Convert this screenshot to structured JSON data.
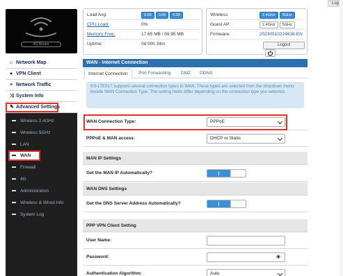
{
  "topbar": {
    "log_label": "Log"
  },
  "logo": {
    "label": "4G Router"
  },
  "status": {
    "load_avg": {
      "label": "Load Avg:",
      "values": [
        "0.00",
        "0.00",
        "0.00"
      ]
    },
    "cpu_load": {
      "label": "CPU Load:",
      "value": "0%"
    },
    "memory_free": {
      "label": "Memory Free:",
      "value": "17.65 MB / 59.95 MB"
    },
    "uptime": {
      "label": "Uptime:",
      "value": "0d 00h 34m"
    },
    "wireless": {
      "label": "Wireless:",
      "bands": [
        "2.4GHz",
        "5GHz"
      ]
    },
    "guest_ap": {
      "label": "Guest AP:",
      "bands": [
        "2.4GHz",
        "5GHz"
      ]
    },
    "firmware": {
      "label": "Firmware:",
      "value": "20230510224638-EN"
    },
    "logout_label": "Logout"
  },
  "sidebar": {
    "items": [
      {
        "label": "Network Map",
        "icon": "home-icon"
      },
      {
        "label": "VPN Client",
        "icon": "globe-icon"
      },
      {
        "label": "Network Traffic",
        "icon": "list-icon"
      },
      {
        "label": "System Info",
        "icon": "shuffle-icon"
      },
      {
        "label": "Advanced Settings",
        "icon": "wrench-icon"
      }
    ],
    "subitems": [
      {
        "label": "Wireless 2.4GHz"
      },
      {
        "label": "Wireless 5GHz"
      },
      {
        "label": "LAN"
      },
      {
        "label": "WAN"
      },
      {
        "label": "Firewall"
      },
      {
        "label": "4G"
      },
      {
        "label": "Administration"
      },
      {
        "label": "Wireless & Wired Info"
      },
      {
        "label": "System Log"
      }
    ]
  },
  "main": {
    "title": "WAN - Internet Connection",
    "tabs": [
      "Internet Connection",
      "Port Forwarding",
      "DMZ",
      "DDNS"
    ],
    "note": "KS-LTE517 supports several connection types to WAN. These types are selected from the dropdown menu beside WAN Connection Type. The setting fields differ depending on the connection type you selected.",
    "wan_type": {
      "label": "WAN Connection Type:",
      "value": "PPPoE"
    },
    "pppoe_mac": {
      "label": "PPPoE & MAN access:",
      "value": "DHCP or Static"
    },
    "man_ip_section": "MAN IP Settings",
    "man_ip_auto": {
      "label": "Get the MAN IP Automatically?",
      "toggle": "I"
    },
    "wan_dns_section": "WAN DNS Settings",
    "dns_auto": {
      "label": "Get the DNS Server Address Automatically?",
      "toggle": "I"
    },
    "ppp_section": "PPP VPN Client Setting",
    "username": {
      "label": "User Name:",
      "value": ""
    },
    "password": {
      "label": "Password:",
      "value": ""
    },
    "auth_algo": {
      "label": "Authentication Algorithm:",
      "value": "Auto"
    }
  },
  "colors": {
    "accent": "#2e6fb0",
    "highlight": "#e0302a",
    "sidebar_bg": "#1f1f1f"
  }
}
